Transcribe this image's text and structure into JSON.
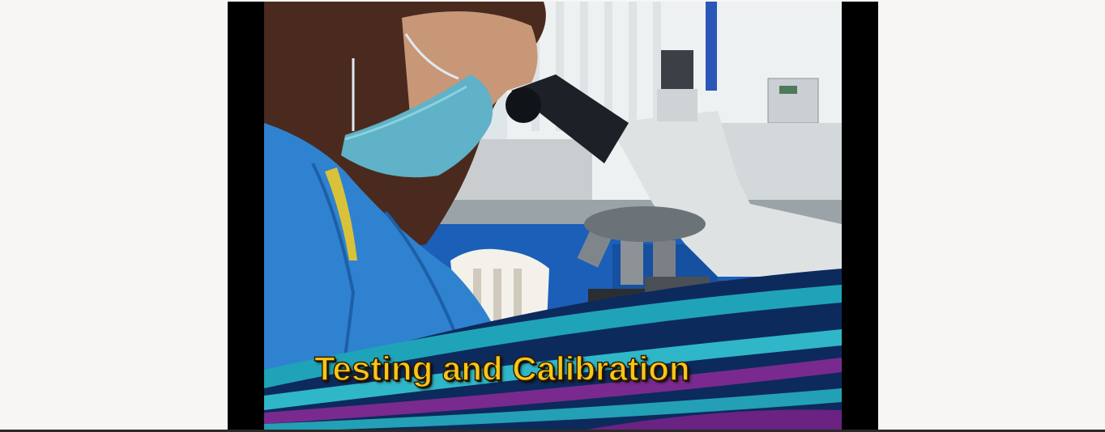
{
  "video": {
    "caption": "Testing and Calibration"
  },
  "icons": {
    "scene": "microscope-lab-photo-icon"
  },
  "colors": {
    "page_background": "#f7f6f4",
    "letterbox": "#000000",
    "caption_fill": "#f9c51a",
    "swoosh_teal": "#1fa3b8",
    "swoosh_purple": "#7a2a8f",
    "swoosh_navy": "#0d2a5c"
  }
}
